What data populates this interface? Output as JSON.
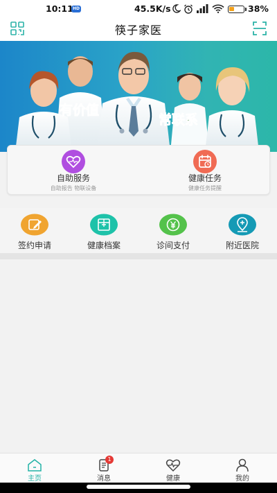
{
  "status_bar": {
    "time": "10:11",
    "badge": "HD",
    "speed": "45.5K/s",
    "battery_level": 0.38,
    "battery_text": "38%"
  },
  "nav": {
    "title": "筷子家医",
    "left_icon": "qr-code-icon",
    "right_icon": "scan-icon"
  },
  "banner": {
    "slogan_left": "有价值",
    "slogan_right": "常联系"
  },
  "services": [
    {
      "title": "自助服务",
      "subtitle": "自助报告 物联设备",
      "icon": "heart-icon",
      "color": "#b04ee0"
    },
    {
      "title": "健康任务",
      "subtitle": "健康任务提醒",
      "icon": "calendar-icon",
      "color": "#f06b54"
    }
  ],
  "quick_actions": [
    {
      "label": "签约申请",
      "icon": "edit-icon",
      "color": "#f0a430"
    },
    {
      "label": "健康档案",
      "icon": "folder-icon",
      "color": "#1ec2a9"
    },
    {
      "label": "诊间支付",
      "icon": "yen-icon",
      "color": "#54c24b"
    },
    {
      "label": "附近医院",
      "icon": "location-icon",
      "color": "#159ab5"
    }
  ],
  "tabs": [
    {
      "label": "主页",
      "icon": "home-icon",
      "active": true
    },
    {
      "label": "消息",
      "icon": "message-icon",
      "badge": "1"
    },
    {
      "label": "健康",
      "icon": "heart-pulse-icon"
    },
    {
      "label": "我的",
      "icon": "user-icon"
    }
  ],
  "colors": {
    "accent": "#23b2a6",
    "banner_start": "#1c86c9",
    "banner_end": "#2cb7a9"
  }
}
